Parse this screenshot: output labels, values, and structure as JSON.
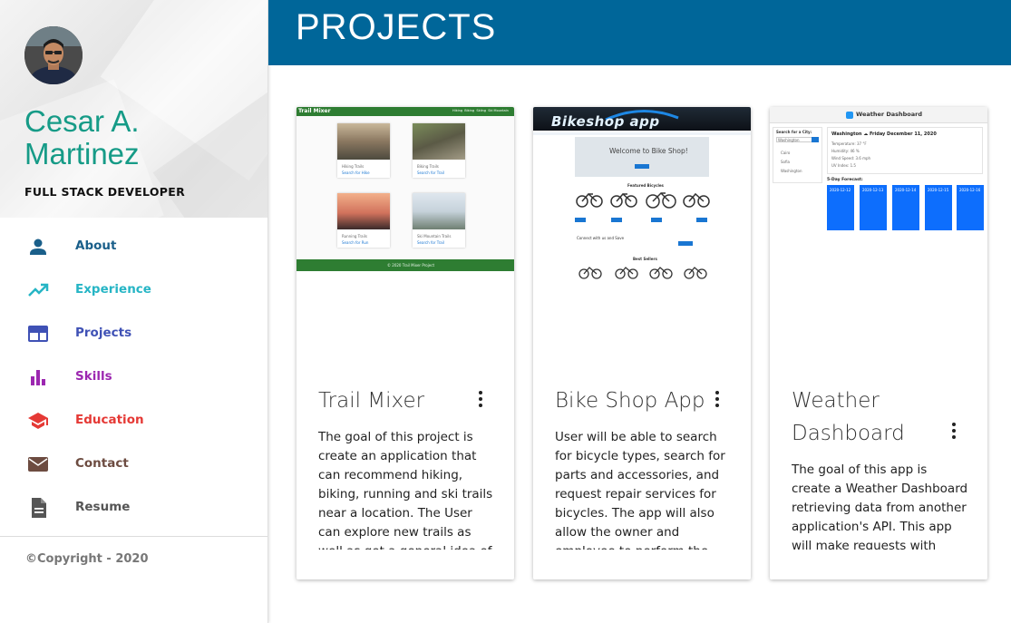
{
  "profile": {
    "name": "Cesar A. Martinez",
    "role": "FULL STACK DEVELOPER"
  },
  "nav": [
    {
      "label": "About",
      "icon": "person-icon",
      "color": "#1a5f8a"
    },
    {
      "label": "Experience",
      "icon": "trending-up-icon",
      "color": "#26b5c5"
    },
    {
      "label": "Projects",
      "icon": "web-layout-icon",
      "color": "#3f51b5"
    },
    {
      "label": "Skills",
      "icon": "bar-chart-icon",
      "color": "#9c27b0"
    },
    {
      "label": "Education",
      "icon": "graduation-cap-icon",
      "color": "#e53935"
    },
    {
      "label": "Contact",
      "icon": "mail-icon",
      "color": "#6d4c41"
    },
    {
      "label": "Resume",
      "icon": "document-icon",
      "color": "#555555"
    }
  ],
  "copyright": "©Copyright - 2020",
  "header": {
    "title": "PROJECTS"
  },
  "colors": {
    "header": "#006699",
    "accent": "#169b87"
  },
  "projects": [
    {
      "title": "Trail Mixer",
      "description": "The goal of this project is create an application that can recommend hiking, biking, running and ski trails near a location. The User can explore new trails as well as get a general idea of what",
      "preview": {
        "app_name": "Trail Mixer",
        "nav": [
          "Hiking",
          "Biking",
          "Skiing",
          "Ski Mountain"
        ],
        "tiles": [
          {
            "label": "Hiking Trails",
            "link": "Search for Hike"
          },
          {
            "label": "Biking Trails",
            "link": "Search for Trail"
          },
          {
            "label": "Running Trails",
            "link": "Search for Run"
          },
          {
            "label": "Ski Mountain Trails",
            "link": "Search for Trail"
          }
        ],
        "footer": "© 2020 Trail Mixer Project"
      }
    },
    {
      "title": "Bike Shop App",
      "description": "User will be able to search for bicycle types, search for parts and accessories, and request repair services for bicycles. The app will also allow the owner and employee to perform the CRUD operations",
      "preview": {
        "banner": "Bikeshop app",
        "welcome": "Welcome to Bike Shop!",
        "featured": "Featured Bicycles",
        "best": "Best Sellers",
        "connect": "Connect with us and Save"
      }
    },
    {
      "title": "Weather Dashboard",
      "description": "The goal of this app is create a Weather Dashboard retrieving data from another application's API. This app will make requests with specific",
      "preview": {
        "app_name": "Weather Dashboard",
        "search_label": "Search for a City:",
        "search_value": "Washington",
        "cities": [
          "Cairo",
          "Sofia",
          "Washington"
        ],
        "current": "Washington ☁ Friday December 11, 2020",
        "stats": [
          "Temperature: 37 °F",
          "Humidity: 46 %",
          "Wind Speed: 3.6 mph",
          "UV Index: 1.5"
        ],
        "forecast_label": "5-Day Forecast:",
        "forecast": [
          "2020-12-12",
          "2020-12-13",
          "2020-12-14",
          "2020-12-15",
          "2020-12-16"
        ]
      }
    }
  ]
}
